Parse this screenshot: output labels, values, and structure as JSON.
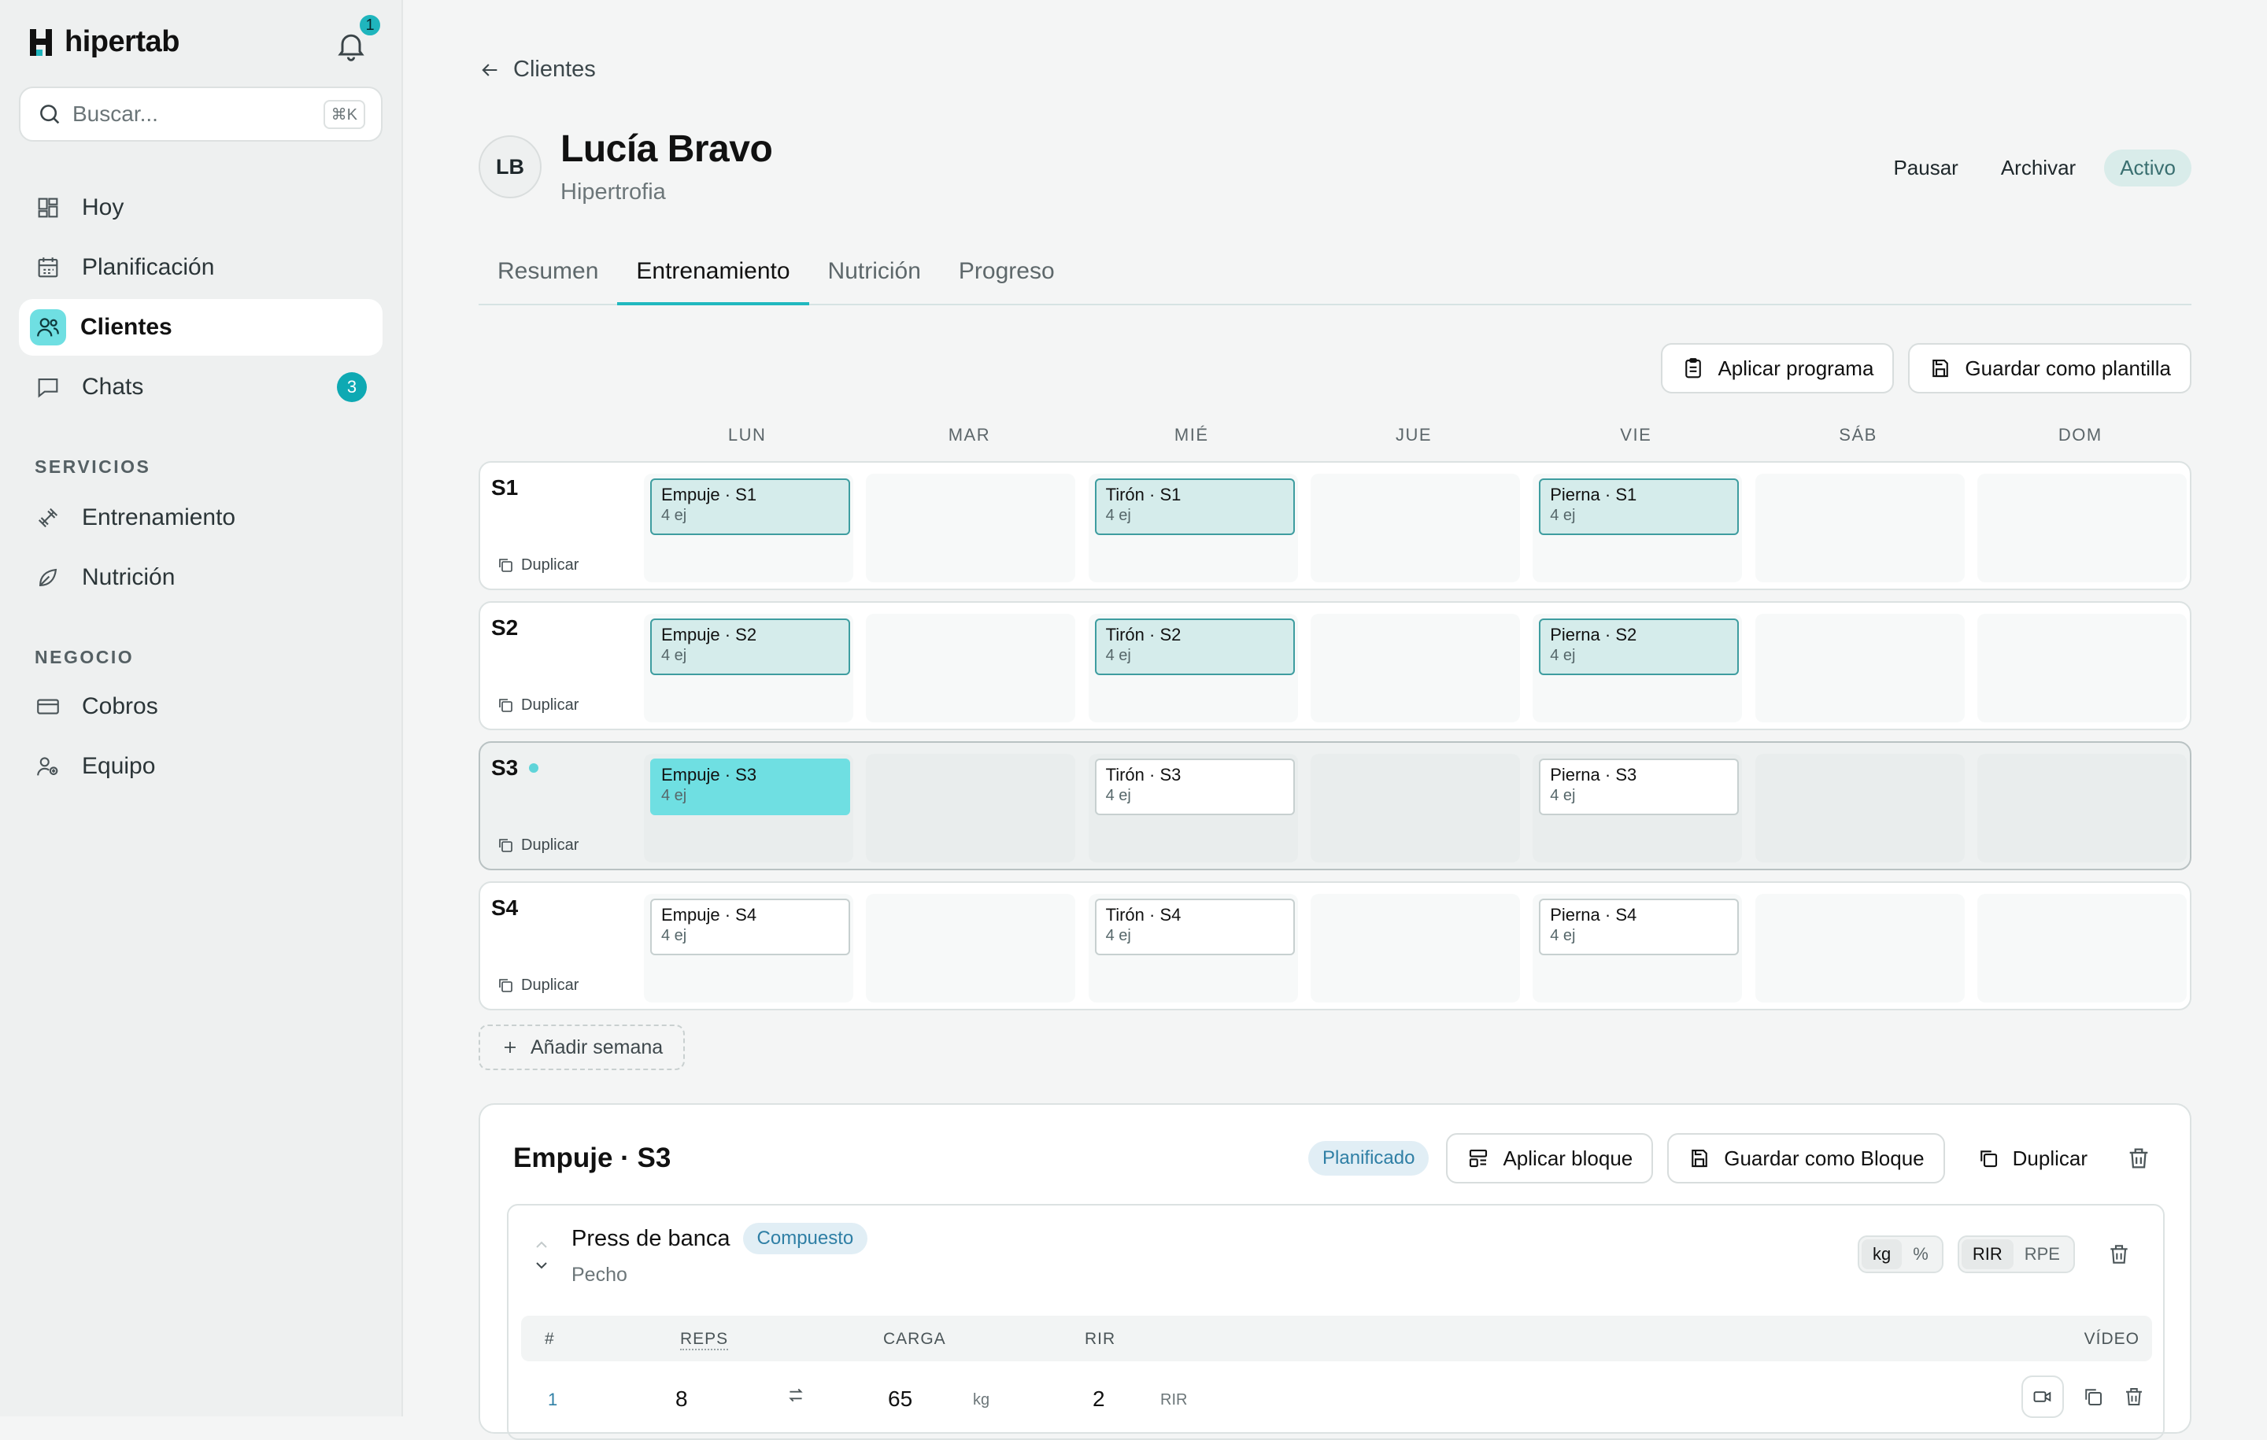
{
  "app": {
    "name": "hipertab",
    "notifications": "1"
  },
  "search": {
    "placeholder": "Buscar...",
    "shortcut": "⌘K"
  },
  "nav": {
    "main": [
      {
        "label": "Hoy",
        "icon": "grid-icon"
      },
      {
        "label": "Planificación",
        "icon": "calendar-icon"
      },
      {
        "label": "Clientes",
        "icon": "users-icon",
        "active": true
      },
      {
        "label": "Chats",
        "icon": "chat-icon",
        "count": "3"
      }
    ],
    "servicios_title": "SERVICIOS",
    "servicios": [
      {
        "label": "Entrenamiento",
        "icon": "dumbbell-icon"
      },
      {
        "label": "Nutrición",
        "icon": "leaf-icon"
      }
    ],
    "negocio_title": "NEGOCIO",
    "negocio": [
      {
        "label": "Cobros",
        "icon": "card-icon"
      },
      {
        "label": "Equipo",
        "icon": "team-icon"
      }
    ]
  },
  "header": {
    "back_label": "Clientes",
    "avatar_initials": "LB",
    "client_name": "Lucía Bravo",
    "client_goal": "Hipertrofia",
    "pause": "Pausar",
    "archive": "Archivar",
    "status": "Activo"
  },
  "tabs": [
    "Resumen",
    "Entrenamiento",
    "Nutrición",
    "Progreso"
  ],
  "active_tab": "Entrenamiento",
  "toolbar": {
    "apply_program": "Aplicar programa",
    "save_template": "Guardar como plantilla"
  },
  "days": [
    "LUN",
    "MAR",
    "MIÉ",
    "JUE",
    "VIE",
    "SÁB",
    "DOM"
  ],
  "duplicate_label": "Duplicar",
  "weeks": [
    {
      "label": "S1",
      "current": false,
      "sessions": [
        {
          "day": 0,
          "name": "Empuje · S1",
          "sub": "4 ej",
          "state": "done"
        },
        {
          "day": 2,
          "name": "Tirón · S1",
          "sub": "4 ej",
          "state": "done"
        },
        {
          "day": 4,
          "name": "Pierna · S1",
          "sub": "4 ej",
          "state": "done"
        }
      ]
    },
    {
      "label": "S2",
      "current": false,
      "sessions": [
        {
          "day": 0,
          "name": "Empuje · S2",
          "sub": "4 ej",
          "state": "done"
        },
        {
          "day": 2,
          "name": "Tirón · S2",
          "sub": "4 ej",
          "state": "done"
        },
        {
          "day": 4,
          "name": "Pierna · S2",
          "sub": "4 ej",
          "state": "done"
        }
      ]
    },
    {
      "label": "S3",
      "current": true,
      "sessions": [
        {
          "day": 0,
          "name": "Empuje · S3",
          "sub": "4 ej",
          "state": "selected"
        },
        {
          "day": 2,
          "name": "Tirón · S3",
          "sub": "4 ej",
          "state": "planned"
        },
        {
          "day": 4,
          "name": "Pierna · S3",
          "sub": "4 ej",
          "state": "planned"
        }
      ]
    },
    {
      "label": "S4",
      "current": false,
      "sessions": [
        {
          "day": 0,
          "name": "Empuje · S4",
          "sub": "4 ej",
          "state": "planned"
        },
        {
          "day": 2,
          "name": "Tirón · S4",
          "sub": "4 ej",
          "state": "planned"
        },
        {
          "day": 4,
          "name": "Pierna · S4",
          "sub": "4 ej",
          "state": "planned"
        }
      ]
    }
  ],
  "add_week": "Añadir semana",
  "block": {
    "title": "Empuje · S3",
    "status": "Planificado",
    "apply_block": "Aplicar bloque",
    "save_block": "Guardar como Bloque",
    "duplicate": "Duplicar",
    "exercise": {
      "name": "Press de banca",
      "tag": "Compuesto",
      "muscle": "Pecho",
      "load_units": [
        "kg",
        "%"
      ],
      "effort_units": [
        "RIR",
        "RPE"
      ],
      "headers": {
        "num": "#",
        "reps": "REPS",
        "load": "CARGA",
        "rir": "RIR",
        "video": "VÍDEO"
      },
      "sets": [
        {
          "num": "1",
          "reps": "8",
          "load": "65",
          "load_unit": "kg",
          "rir": "2",
          "rir_unit": "RIR"
        }
      ]
    }
  },
  "colors": {
    "accent": "#1fb5bd",
    "selected_session": "#6fdfe2",
    "done_session": "#d5eceb"
  }
}
